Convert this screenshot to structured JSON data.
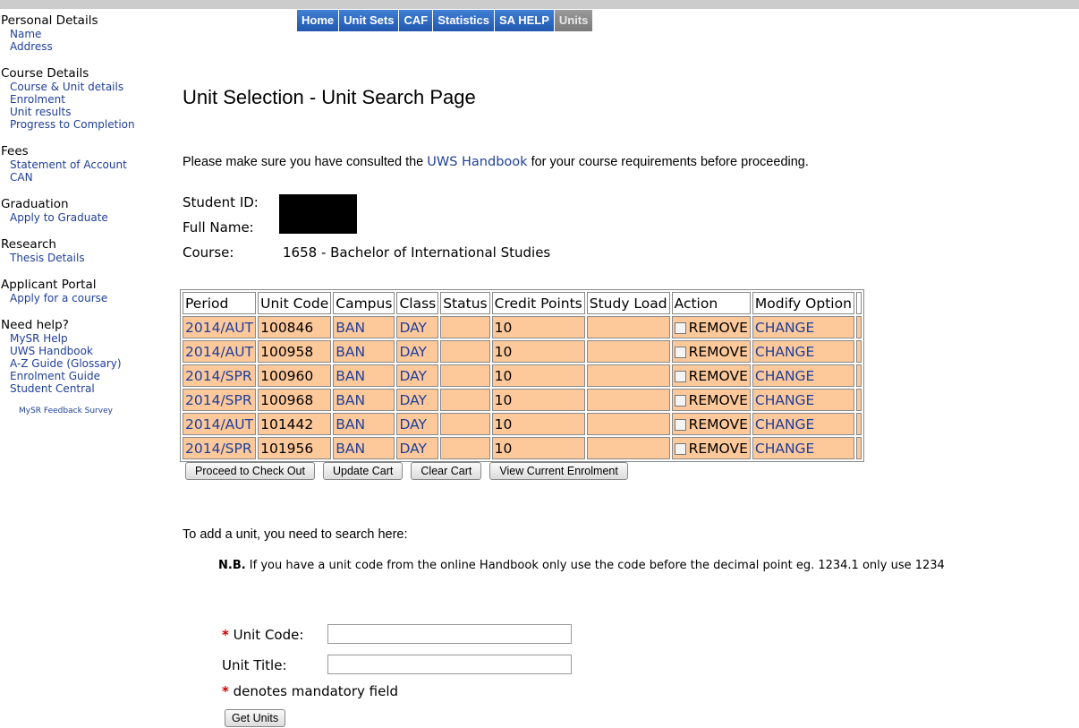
{
  "sidebar": [
    {
      "title": "Personal Details",
      "items": [
        "Name",
        "Address"
      ]
    },
    {
      "title": "Course Details",
      "items": [
        "Course & Unit details",
        "Enrolment",
        "Unit results",
        "Progress to Completion"
      ]
    },
    {
      "title": "Fees",
      "items": [
        "Statement of Account",
        "CAN"
      ]
    },
    {
      "title": "Graduation",
      "items": [
        "Apply to Graduate"
      ]
    },
    {
      "title": "Research",
      "items": [
        "Thesis Details"
      ]
    },
    {
      "title": "Applicant Portal",
      "items": [
        "Apply for a course"
      ]
    },
    {
      "title": "Need help?",
      "items": [
        "MySR Help",
        "UWS Handbook",
        "A-Z Guide (Glossary)",
        "Enrolment Guide",
        "Student Central"
      ]
    }
  ],
  "feedback_link": "MySR Feedback Survey",
  "tabs": [
    "Home",
    "Unit Sets",
    "CAF",
    "Statistics",
    "SA HELP",
    "Units"
  ],
  "active_tab": "Units",
  "page_title": "Unit Selection - Unit Search Page",
  "consult": {
    "before": "Please make sure you have consulted the ",
    "link": "UWS Handbook",
    "after": " for your course requirements before proceeding."
  },
  "student": {
    "id_label": "Student ID:",
    "name_label": "Full Name:",
    "course_label": "Course:",
    "course_value": "1658 - Bachelor of International Studies"
  },
  "table": {
    "headers": [
      "Period",
      "Unit Code",
      "Campus",
      "Class",
      "Status",
      "Credit Points",
      "Study Load",
      "Action",
      "Modify Option"
    ],
    "rows": [
      {
        "period": "2014/AUT",
        "code": "100846",
        "campus": "BAN",
        "class": "DAY",
        "status": "",
        "credit": "10",
        "load": "",
        "action": "REMOVE",
        "modify": "CHANGE"
      },
      {
        "period": "2014/AUT",
        "code": "100958",
        "campus": "BAN",
        "class": "DAY",
        "status": "",
        "credit": "10",
        "load": "",
        "action": "REMOVE",
        "modify": "CHANGE"
      },
      {
        "period": "2014/SPR",
        "code": "100960",
        "campus": "BAN",
        "class": "DAY",
        "status": "",
        "credit": "10",
        "load": "",
        "action": "REMOVE",
        "modify": "CHANGE"
      },
      {
        "period": "2014/SPR",
        "code": "100968",
        "campus": "BAN",
        "class": "DAY",
        "status": "",
        "credit": "10",
        "load": "",
        "action": "REMOVE",
        "modify": "CHANGE"
      },
      {
        "period": "2014/AUT",
        "code": "101442",
        "campus": "BAN",
        "class": "DAY",
        "status": "",
        "credit": "10",
        "load": "",
        "action": "REMOVE",
        "modify": "CHANGE"
      },
      {
        "period": "2014/SPR",
        "code": "101956",
        "campus": "BAN",
        "class": "DAY",
        "status": "",
        "credit": "10",
        "load": "",
        "action": "REMOVE",
        "modify": "CHANGE"
      }
    ]
  },
  "buttons": {
    "checkout": "Proceed to Check Out",
    "update": "Update Cart",
    "clear": "Clear Cart",
    "view": "View Current Enrolment"
  },
  "add_text": "To add a unit, you need to search here:",
  "nb": {
    "bold": "N.B.",
    "text": " If you have a unit code from the online Handbook only use the code before the decimal point eg. 1234.1 only use 1234"
  },
  "search": {
    "req_mark": "*",
    "unit_code_label": "Unit Code:",
    "unit_code_value": "",
    "unit_title_label": "Unit Title:",
    "unit_title_value": "",
    "mandatory": "denotes mandatory field",
    "get_units": "Get Units"
  },
  "colors": {
    "tab_bg": "#2e6dc4",
    "active_tab_bg": "#8a8a8a",
    "row_bg": "#fdc99b",
    "link": "#1f3f99",
    "required": "#cc0000"
  }
}
